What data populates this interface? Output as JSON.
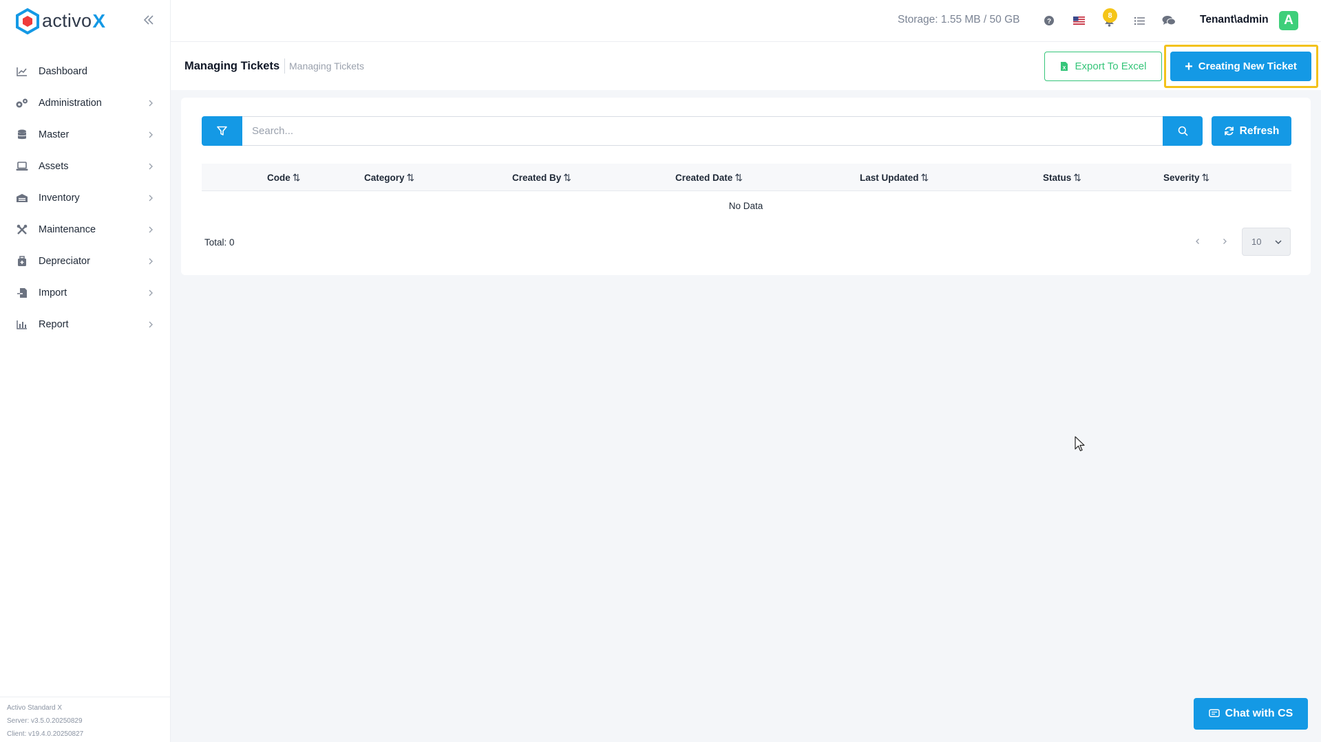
{
  "brand": {
    "name": "activo",
    "name_suffix": "X",
    "accent": "#1499e5"
  },
  "sidebar": {
    "items": [
      {
        "label": "Dashboard",
        "icon": "chart-line-icon",
        "has_children": false
      },
      {
        "label": "Administration",
        "icon": "gears-icon",
        "has_children": true
      },
      {
        "label": "Master",
        "icon": "database-icon",
        "has_children": true
      },
      {
        "label": "Assets",
        "icon": "laptop-icon",
        "has_children": true
      },
      {
        "label": "Inventory",
        "icon": "warehouse-icon",
        "has_children": true
      },
      {
        "label": "Maintenance",
        "icon": "tools-icon",
        "has_children": true
      },
      {
        "label": "Depreciator",
        "icon": "briefcase-medical-icon",
        "has_children": true
      },
      {
        "label": "Import",
        "icon": "file-import-icon",
        "has_children": true
      },
      {
        "label": "Report",
        "icon": "bar-chart-icon",
        "has_children": true
      }
    ],
    "version": {
      "product": "Activo Standard X",
      "server": "Server: v3.5.0.20250829",
      "client": "Client: v19.4.0.20250827"
    }
  },
  "topbar": {
    "storage": "Storage: 1.55 MB / 50 GB",
    "notification_count": "8",
    "user": "Tenant\\admin",
    "avatar_letter": "A",
    "avatar_color": "#3ecf7a"
  },
  "page": {
    "title": "Managing Tickets",
    "breadcrumb": "Managing Tickets",
    "export_label": "Export To Excel",
    "create_label": "Creating New Ticket"
  },
  "table": {
    "search_placeholder": "Search...",
    "refresh_label": "Refresh",
    "columns": [
      "Code",
      "Category",
      "Created By",
      "Created Date",
      "Last Updated",
      "Status",
      "Severity"
    ],
    "empty_text": "No Data",
    "total": "Total: 0",
    "page_size": "10"
  },
  "chat": {
    "label": "Chat with CS"
  }
}
